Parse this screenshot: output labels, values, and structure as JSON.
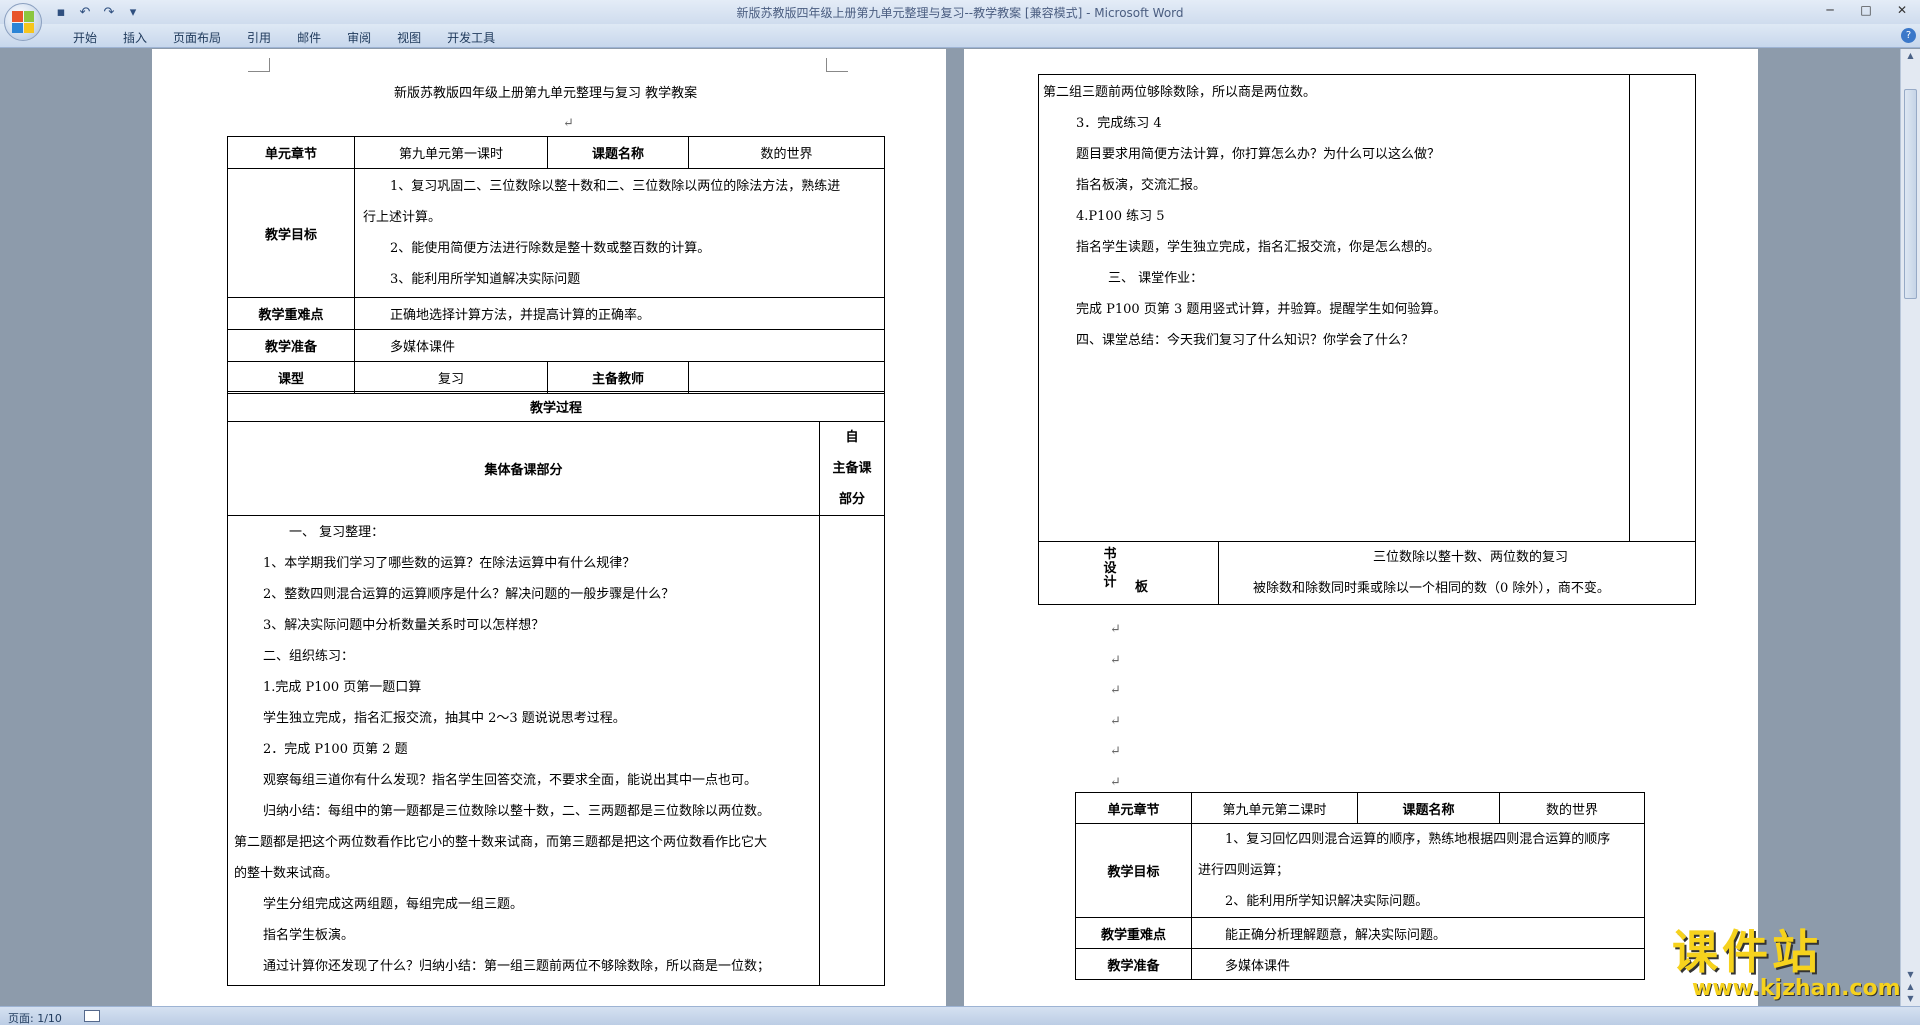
{
  "window": {
    "title": "新版苏教版四年级上册第九单元整理与复习--教学教案 [兼容模式] - Microsoft Word",
    "minimize": "─",
    "maximize": "□",
    "close": "✕"
  },
  "ribbon": {
    "tabs": [
      "开始",
      "插入",
      "页面布局",
      "引用",
      "邮件",
      "审阅",
      "视图",
      "开发工具"
    ],
    "help": "?"
  },
  "page1": {
    "title": "新版苏教版四年级上册第九单元整理与复习   教学教案",
    "unit_label": "单元章节",
    "unit_value": "第九单元第一课时",
    "lesson_label": "课题名称",
    "lesson_value": "数的世界",
    "goal_label": "教学目标",
    "goals": [
      "1、复习巩固二、三位数除以整十数和二、三位数除以两位的除法方法，熟练进",
      "行上述计算。",
      "2、能使用简便方法进行除数是整十数或整百数的计算。",
      "3、能利用所学知道解决实际问题"
    ],
    "key_label": "教学重难点",
    "key_value": "正确地选择计算方法，并提高计算的正确率。",
    "prep_label": "教学准备",
    "prep_value": "多媒体课件",
    "type_label": "课型",
    "type_value": "复习",
    "teacher_label": "主备教师",
    "process_label": "教学过程",
    "collective_label": "集体备课部分",
    "self_label": [
      "自",
      "主备课",
      "部分"
    ],
    "process_lines": [
      "一、    复习整理：",
      "1、本学期我们学习了哪些数的运算？在除法运算中有什么规律？",
      "2、整数四则混合运算的运算顺序是什么？解决问题的一般步骤是什么？",
      "3、解决实际问题中分析数量关系时可以怎样想？",
      "二、组织练习：",
      "1.完成 P100 页第一题口算",
      "学生独立完成，指名汇报交流，抽其中 2～3 题说说思考过程。",
      "2．完成 P100 页第 2 题",
      "观察每组三道你有什么发现？指名学生回答交流，不要求全面，能说出其中一点也可。",
      "归纳小结：每组中的第一题都是三位数除以整十数，二、三两题都是三位数除以两位数。",
      "第二题都是把这个两位数看作比它小的整十数来试商，而第三题都是把这个两位数看作比它大",
      "的整十数来试商。",
      "学生分组完成这两组题，每组完成一组三题。",
      "指名学生板演。",
      "通过计算你还发现了什么？归纳小结：第一组三题前两位不够除数除，所以商是一位数；"
    ]
  },
  "page2": {
    "cont_lines": [
      "第二组三题前两位够除数除，所以商是两位数。",
      "3．完成练习 4",
      "题目要求用简便方法计算，你打算怎么办？为什么可以这么做？",
      "指名板演，交流汇报。",
      "4.P100 练习 5",
      "指名学生读题，学生独立完成，指名汇报交流，你是怎么想的。",
      "三、    课堂作业：",
      "完成 P100 页第 3 题用竖式计算，并验算。提醒学生如何验算。",
      "四、课堂总结：今天我们复习了什么知识？你学会了什么？"
    ],
    "board_label_v": "书设计",
    "board_label_h": "板",
    "board_lines": [
      "三位数除以整十数、两位数的复习",
      "被除数和除数同时乘或除以一个相同的数（0 除外），商不变。"
    ],
    "unit_label": "单元章节",
    "unit_value": "第九单元第二课时",
    "lesson_label": "课题名称",
    "lesson_value": "数的世界",
    "goal_label": "教学目标",
    "goals": [
      "1、复习回忆四则混合运算的顺序，熟练地根据四则混合运算的顺序",
      "进行四则运算；",
      "2、能利用所学知识解决实际问题。"
    ],
    "key_label": "教学重难点",
    "key_value": "能正确分析理解题意，解决实际问题。",
    "prep_label": "教学准备",
    "prep_value": "多媒体课件"
  },
  "status": {
    "page": "页面: 1/10"
  },
  "watermark": {
    "title": "课件站",
    "url": "www.kjzhan.com"
  }
}
